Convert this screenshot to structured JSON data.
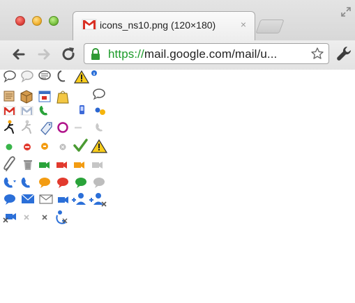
{
  "window": {
    "traffic_lights": [
      "close",
      "minimize",
      "zoom"
    ]
  },
  "tab": {
    "title": "icons_ns10.png (120×180)",
    "close_glyph": "×",
    "favicon": "gmail-icon"
  },
  "toolbar": {
    "back": "back-arrow-icon",
    "forward": "forward-arrow-icon",
    "reload": "reload-icon",
    "wrench": "wrench-icon"
  },
  "omnibox": {
    "scheme": "https://",
    "rest": "mail.google.com/mail/u...",
    "secure_color": "#1a9a27"
  },
  "sprite_sheet": {
    "rows": [
      [
        "speech-bubble-icon",
        "speech-bubble-gray-icon",
        "chat-list-icon",
        "phone-handset-icon",
        "warning-triangle-icon",
        "info-icon"
      ],
      [
        "notebook-icon",
        "package-icon",
        "calendar-icon",
        "shopping-bag-icon",
        "",
        "speech-bubble-outline-icon"
      ],
      [
        "gmail-red-icon",
        "gmail-gray-icon",
        "phone-green-icon",
        "",
        "mobile-phone-icon",
        "people-icon"
      ],
      [
        "aim-runner-icon",
        "aim-runner-gray-icon",
        "tag-icon",
        "orkut-ring-icon",
        "dash-icon",
        "phone-gray-icon"
      ],
      [
        "status-green-icon",
        "status-red-icon",
        "status-orange-icon",
        "status-gray-icon",
        "checkmark-icon",
        "warning-triangle-icon"
      ],
      [
        "paperclip-icon",
        "trash-icon",
        "video-green-icon",
        "video-red-icon",
        "video-orange-icon",
        "video-gray-icon"
      ],
      [
        "phone-dropdown-icon",
        "phone-blue-icon",
        "chat-orange-icon",
        "chat-red-icon",
        "chat-green-icon",
        "chat-gray-icon"
      ],
      [
        "chat-blue-icon",
        "envelope-blue-icon",
        "envelope-outline-icon",
        "video-blue-icon",
        "add-person-icon",
        "add-person-plus-icon"
      ],
      [
        "video-blue-x-icon",
        "close-gray-icon",
        "close-dark-icon",
        "phone-person-icon"
      ]
    ]
  }
}
